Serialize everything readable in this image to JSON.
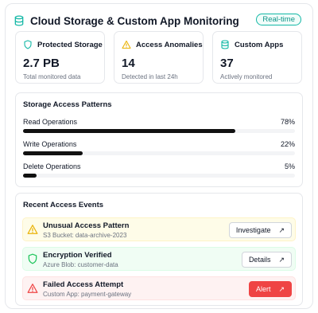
{
  "header": {
    "title": "Cloud Storage & Custom App Monitoring",
    "badge": "Real-time"
  },
  "stats": [
    {
      "label": "Protected Storage",
      "value": "2.7 PB",
      "sub": "Total monitored data",
      "icon": "shield-icon"
    },
    {
      "label": "Access Anomalies",
      "value": "14",
      "sub": "Detected in last 24h",
      "icon": "alert-triangle-icon"
    },
    {
      "label": "Custom Apps",
      "value": "37",
      "sub": "Actively monitored",
      "icon": "database-icon"
    }
  ],
  "patterns": {
    "title": "Storage Access Patterns",
    "items": [
      {
        "name": "Read Operations",
        "percent": "78%",
        "fraction": 0.78
      },
      {
        "name": "Write Operations",
        "percent": "22%",
        "fraction": 0.22
      },
      {
        "name": "Delete Operations",
        "percent": "5%",
        "fraction": 0.05
      }
    ]
  },
  "events": {
    "title": "Recent Access Events",
    "items": [
      {
        "title": "Unusual Access Pattern",
        "source": "S3 Bucket: data-archive-2023",
        "action": "Investigate",
        "status": "warning"
      },
      {
        "title": "Encryption Verified",
        "source": "Azure Blob: customer-data",
        "action": "Details",
        "status": "success"
      },
      {
        "title": "Failed Access Attempt",
        "source": "Custom App: payment-gateway",
        "action": "Alert",
        "status": "error"
      }
    ]
  },
  "colors": {
    "accent": "#14b8a6",
    "warning": "#eab308",
    "success": "#22c55e",
    "error": "#ef4444"
  }
}
